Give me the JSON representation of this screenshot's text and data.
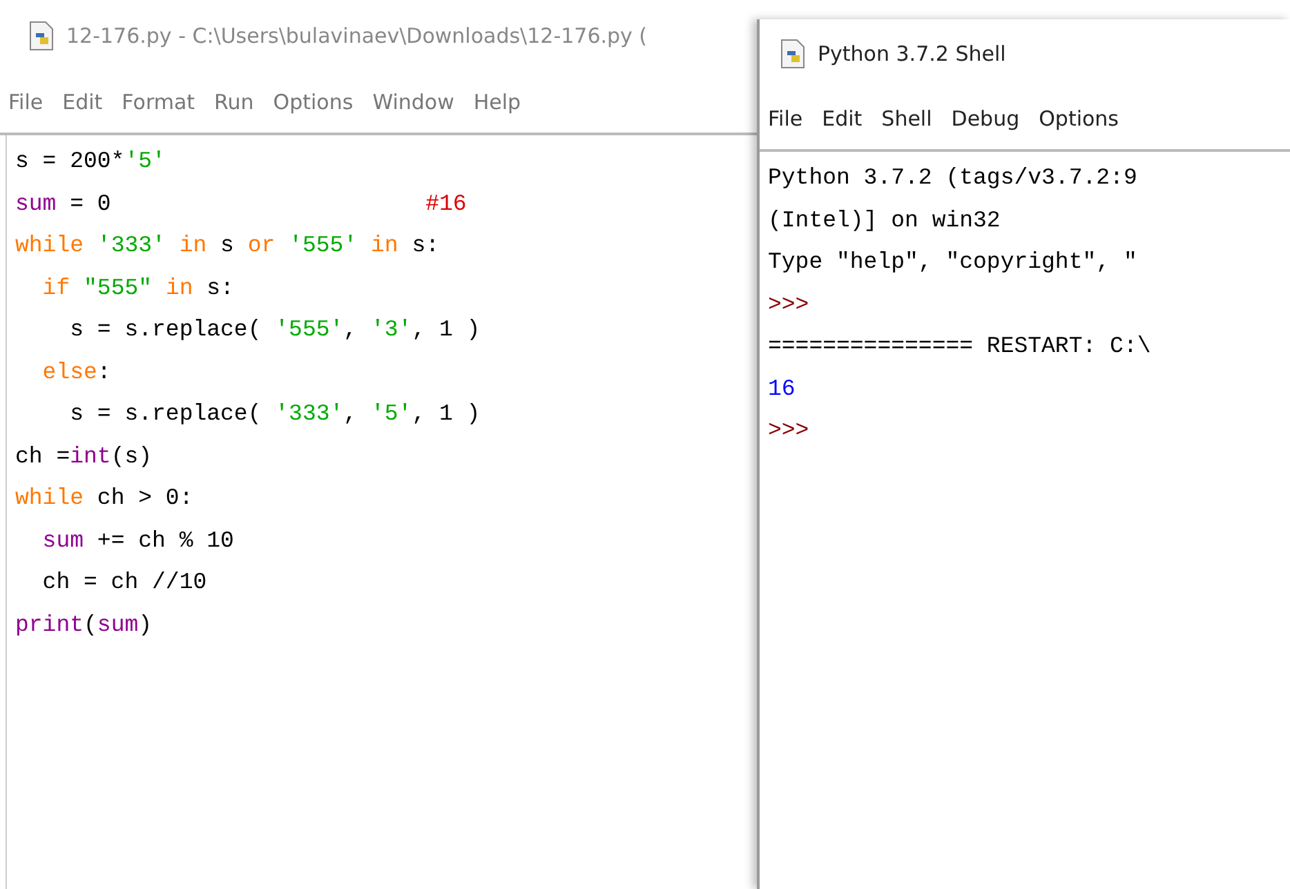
{
  "editor": {
    "title": "12-176.py - C:\\Users\\bulavinaev\\Downloads\\12-176.py (",
    "menu": [
      "File",
      "Edit",
      "Format",
      "Run",
      "Options",
      "Window",
      "Help"
    ],
    "lines": [
      [
        {
          "kind": "plain",
          "text": "s = 200*"
        },
        {
          "kind": "string",
          "text": "'5'"
        }
      ],
      [
        {
          "kind": "builtin",
          "text": "sum"
        },
        {
          "kind": "plain",
          "text": " = 0                       "
        },
        {
          "kind": "comment",
          "text": "#16"
        }
      ],
      [
        {
          "kind": "keyword",
          "text": "while "
        },
        {
          "kind": "string",
          "text": "'333' "
        },
        {
          "kind": "keyword",
          "text": "in"
        },
        {
          "kind": "plain",
          "text": " s "
        },
        {
          "kind": "keyword",
          "text": "or "
        },
        {
          "kind": "string",
          "text": "'555' "
        },
        {
          "kind": "keyword",
          "text": "in"
        },
        {
          "kind": "plain",
          "text": " s:"
        }
      ],
      [
        {
          "kind": "keyword",
          "text": "  if "
        },
        {
          "kind": "string",
          "text": "\"555\" "
        },
        {
          "kind": "keyword",
          "text": "in"
        },
        {
          "kind": "plain",
          "text": " s:"
        }
      ],
      [
        {
          "kind": "plain",
          "text": "    s = s.replace( "
        },
        {
          "kind": "string",
          "text": "'555'"
        },
        {
          "kind": "plain",
          "text": ", "
        },
        {
          "kind": "string",
          "text": "'3'"
        },
        {
          "kind": "plain",
          "text": ", 1 )"
        }
      ],
      [
        {
          "kind": "keyword",
          "text": "  else"
        },
        {
          "kind": "plain",
          "text": ":"
        }
      ],
      [
        {
          "kind": "plain",
          "text": "    s = s.replace( "
        },
        {
          "kind": "string",
          "text": "'333'"
        },
        {
          "kind": "plain",
          "text": ", "
        },
        {
          "kind": "string",
          "text": "'5'"
        },
        {
          "kind": "plain",
          "text": ", 1 )"
        }
      ],
      [
        {
          "kind": "plain",
          "text": "ch ="
        },
        {
          "kind": "builtin",
          "text": "int"
        },
        {
          "kind": "plain",
          "text": "(s)"
        }
      ],
      [
        {
          "kind": "keyword",
          "text": "while"
        },
        {
          "kind": "plain",
          "text": " ch > 0:"
        }
      ],
      [
        {
          "kind": "builtin",
          "text": "  sum"
        },
        {
          "kind": "plain",
          "text": " += ch % 10"
        }
      ],
      [
        {
          "kind": "plain",
          "text": "  ch = ch //10"
        }
      ],
      [
        {
          "kind": "builtin",
          "text": "print"
        },
        {
          "kind": "plain",
          "text": "("
        },
        {
          "kind": "builtin",
          "text": "sum"
        },
        {
          "kind": "plain",
          "text": ")"
        }
      ]
    ]
  },
  "shell": {
    "title": "Python 3.7.2 Shell",
    "menu": [
      "File",
      "Edit",
      "Shell",
      "Debug",
      "Options"
    ],
    "lines": [
      {
        "kind": "plain",
        "text": "Python 3.7.2 (tags/v3.7.2:9"
      },
      {
        "kind": "plain",
        "text": "(Intel)] on win32"
      },
      {
        "kind": "plain",
        "text": "Type \"help\", \"copyright\", \""
      },
      {
        "kind": "prompt",
        "text": ">>>"
      },
      {
        "kind": "plain",
        "text": "=============== RESTART: C:\\"
      },
      {
        "kind": "output",
        "text": "16"
      },
      {
        "kind": "prompt",
        "text": ">>>"
      }
    ]
  }
}
